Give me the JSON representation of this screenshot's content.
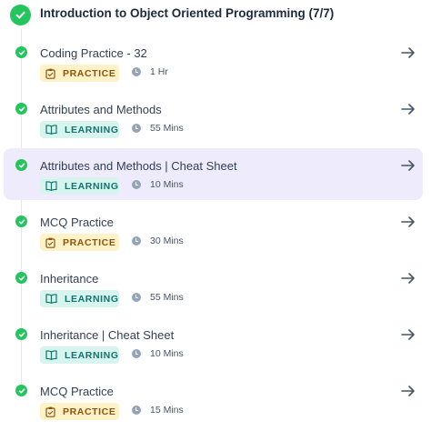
{
  "header": {
    "title": "Introduction to Object Oriented Programming (7/7)"
  },
  "items": [
    {
      "title": "Coding Practice - 32",
      "type": "PRACTICE",
      "duration": "1 Hr"
    },
    {
      "title": "Attributes and Methods",
      "type": "LEARNING",
      "duration": "55 Mins"
    },
    {
      "title": "Attributes and Methods | Cheat Sheet",
      "type": "LEARNING",
      "duration": "10 Mins"
    },
    {
      "title": "MCQ Practice",
      "type": "PRACTICE",
      "duration": "30 Mins"
    },
    {
      "title": "Inheritance",
      "type": "LEARNING",
      "duration": "55 Mins"
    },
    {
      "title": "Inheritance | Cheat Sheet",
      "type": "LEARNING",
      "duration": "10 Mins"
    },
    {
      "title": "MCQ Practice",
      "type": "PRACTICE",
      "duration": "15 Mins"
    }
  ],
  "colors": {
    "complete_green": "#22c55e",
    "active_background": "#eeecfc",
    "practice_badge_bg": "#fdf2c8",
    "practice_badge_text": "#92520b",
    "learning_badge_bg": "#d7f4ef",
    "learning_badge_text": "#0f766e"
  },
  "icons": {
    "header": "check-circle-icon",
    "item_status": "check-circle-icon",
    "practice": "clipboard-icon",
    "learning": "book-open-icon",
    "duration": "clock-icon",
    "open": "arrow-right-icon"
  }
}
